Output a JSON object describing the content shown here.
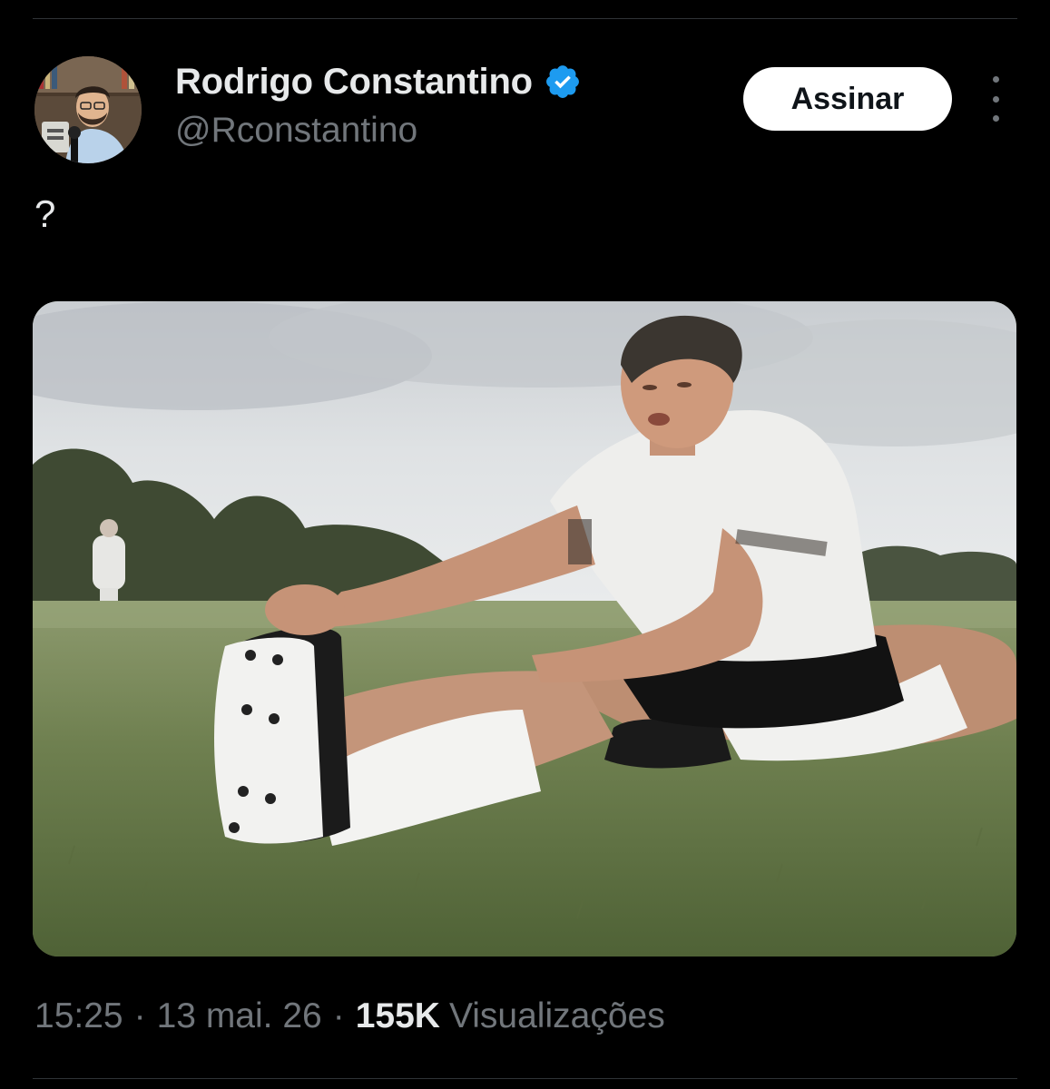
{
  "author": {
    "name": "Rodrigo Constantino",
    "handle": "@Rconstantino",
    "verified_icon": "verified-badge-icon",
    "verified_color": "#1d9bf0"
  },
  "header": {
    "subscribe_label": "Assinar",
    "more_icon": "more-vertical-icon"
  },
  "tweet": {
    "text": "?",
    "media_description": "photo"
  },
  "meta": {
    "time": "15:25",
    "separator": "·",
    "date": "13 mai. 26",
    "views_count": "155K",
    "views_label": "Visualizações"
  },
  "colors": {
    "background": "#000000",
    "primary_text": "#e7e9ea",
    "secondary_text": "#71767b",
    "button_bg": "#ffffff",
    "button_text": "#0f1419"
  }
}
